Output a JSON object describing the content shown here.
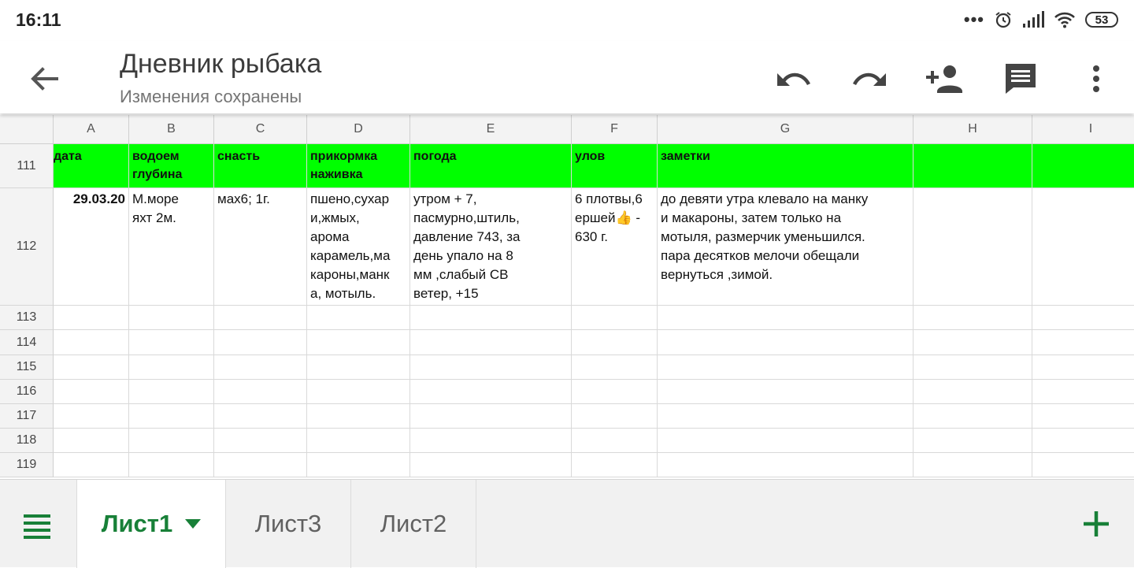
{
  "status": {
    "time": "16:11",
    "battery": "53"
  },
  "app": {
    "title": "Дневник рыбака",
    "subtitle": "Изменения сохранены"
  },
  "columns": [
    "A",
    "B",
    "C",
    "D",
    "E",
    "F",
    "G",
    "H",
    "I"
  ],
  "rows": [
    {
      "num": "111",
      "header": true,
      "cells": [
        "дата",
        "водоем\nглубина",
        "снасть",
        "прикормка\nнаживка",
        "погода",
        "улов",
        "заметки",
        "",
        ""
      ]
    },
    {
      "num": "112",
      "header": false,
      "cells": [
        "29.03.20",
        "М.море\nяхт 2м.",
        "мах6; 1г.",
        "пшено,сухар\nи,жмых,\nарома\nкарамель,ма\nкароны,манк\nа, мотыль.",
        "утром + 7,\nпасмурно,штиль,\nдавление 743, за\nдень упало на  8\nмм ,слабый СВ\nветер, +15",
        "6 плотвы,6\nершей👍  -\n630 г.",
        "до девяти утра клевало на манку\nи макароны, затем только на\nмотыля, размерчик уменьшился.\nпара десятков мелочи  обещали\nвернуться ,зимой.",
        "",
        ""
      ]
    },
    {
      "num": "113",
      "header": false,
      "cells": [
        "",
        "",
        "",
        "",
        "",
        "",
        "",
        "",
        ""
      ]
    },
    {
      "num": "114",
      "header": false,
      "cells": [
        "",
        "",
        "",
        "",
        "",
        "",
        "",
        "",
        ""
      ]
    },
    {
      "num": "115",
      "header": false,
      "cells": [
        "",
        "",
        "",
        "",
        "",
        "",
        "",
        "",
        ""
      ]
    },
    {
      "num": "116",
      "header": false,
      "cells": [
        "",
        "",
        "",
        "",
        "",
        "",
        "",
        "",
        ""
      ]
    },
    {
      "num": "117",
      "header": false,
      "cells": [
        "",
        "",
        "",
        "",
        "",
        "",
        "",
        "",
        ""
      ]
    },
    {
      "num": "118",
      "header": false,
      "cells": [
        "",
        "",
        "",
        "",
        "",
        "",
        "",
        "",
        ""
      ]
    },
    {
      "num": "119",
      "header": false,
      "cells": [
        "",
        "",
        "",
        "",
        "",
        "",
        "",
        "",
        ""
      ]
    }
  ],
  "sheets": [
    {
      "label": "Лист1",
      "active": true
    },
    {
      "label": "Лист3",
      "active": false
    },
    {
      "label": "Лист2",
      "active": false
    }
  ],
  "colors": {
    "header_fill": "#00ff00",
    "accent": "#188038"
  },
  "icons": [
    "back-arrow-icon",
    "undo-icon",
    "redo-icon",
    "add-person-icon",
    "comment-icon",
    "more-vert-icon",
    "menu-icon",
    "plus-icon"
  ]
}
